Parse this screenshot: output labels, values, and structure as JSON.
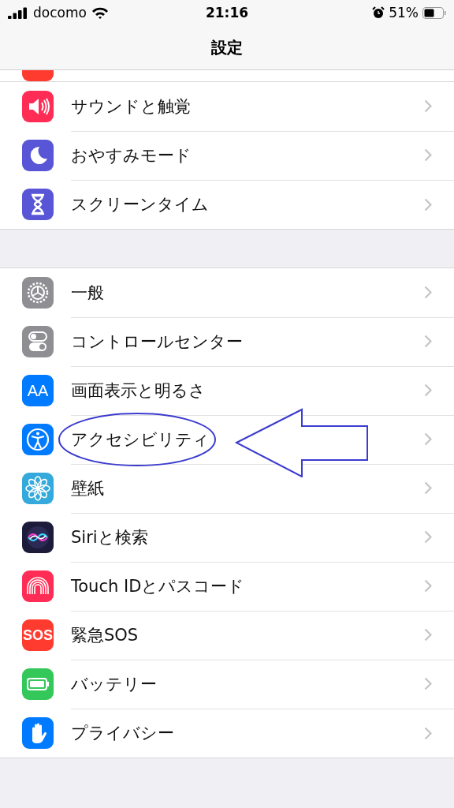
{
  "status_bar": {
    "carrier": "docomo",
    "time": "21:16",
    "battery_percent": "51%"
  },
  "nav_bar": {
    "title": "設定"
  },
  "partial_row": {
    "color": "#ff3b30"
  },
  "sections": [
    {
      "rows": [
        {
          "label": "サウンドと触覚",
          "color": "#ff2d55",
          "highlighted": false
        },
        {
          "label": "おやすみモード",
          "color": "#5856d6",
          "highlighted": false
        },
        {
          "label": "スクリーンタイム",
          "color": "#5856d6",
          "highlighted": false
        }
      ]
    },
    {
      "rows": [
        {
          "label": "一般",
          "color": "#8e8e93",
          "highlighted": false
        },
        {
          "label": "コントロールセンター",
          "color": "#8e8e93",
          "highlighted": false
        },
        {
          "label": "画面表示と明るさ",
          "color": "#007aff",
          "highlighted": false,
          "icon_text": "AA"
        },
        {
          "label": "アクセシビリティ",
          "color": "#007aff",
          "highlighted": true
        },
        {
          "label": "壁紙",
          "color": "#34aadc",
          "highlighted": false
        },
        {
          "label": "Siriと検索",
          "color": "#1c1c3a",
          "highlighted": false
        },
        {
          "label": "Touch IDとパスコード",
          "color": "#ff2d55",
          "highlighted": false
        },
        {
          "label": "緊急SOS",
          "color": "#ff3b30",
          "highlighted": false,
          "icon_text": "SOS"
        },
        {
          "label": "バッテリー",
          "color": "#34c759",
          "highlighted": false
        },
        {
          "label": "プライバシー",
          "color": "#007aff",
          "highlighted": false
        }
      ]
    }
  ]
}
